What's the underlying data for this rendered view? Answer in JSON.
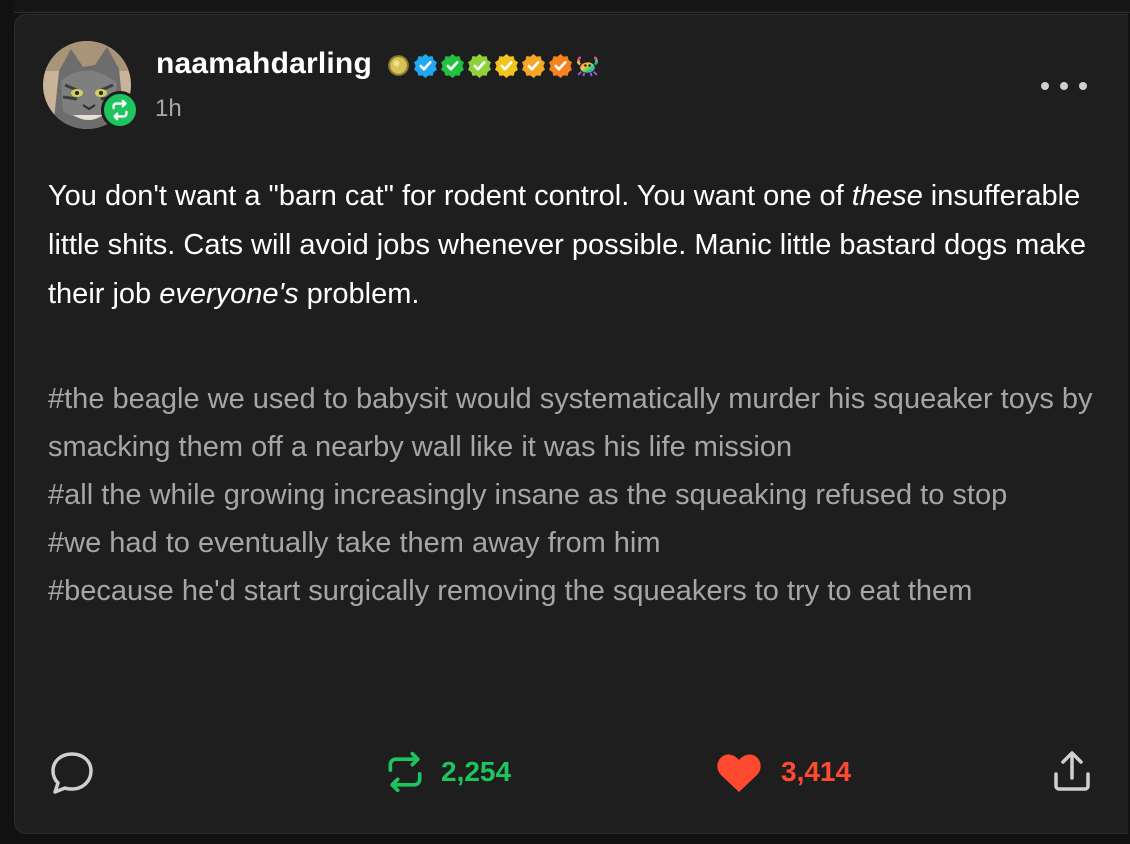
{
  "post": {
    "username": "naamahdarling",
    "timestamp": "1h",
    "body": {
      "p1_a": "You don't want a \"barn cat\" for rodent control. You want one of ",
      "p1_em": "these",
      "p1_b": " insufferable little shits. Cats will avoid jobs whenever possible. Manic little bastard dogs make their job ",
      "p1_em2": "everyone's",
      "p1_c": " problem."
    },
    "tags": [
      "#the beagle we used to babysit would systematically murder his squeaker toys by smacking them off a nearby wall like it was his life mission",
      "#all the while growing increasingly insane as the squeaking refused to stop",
      "#we had to eventually take them away from him",
      "#because he'd start surgically removing the squeakers to try to eat them"
    ],
    "reblogs": "2,254",
    "likes": "3,414"
  },
  "icons": {
    "avatar": "gray-cat-avatar",
    "reblog_badge": "reblog-icon",
    "badges": [
      "coin-badge",
      "blue-check-badge",
      "green-check-badge",
      "lime-check-badge",
      "yellow-check-badge",
      "orange-check-badge",
      "rainbow-crab-badge"
    ],
    "reply": "speech-bubble-icon",
    "reblog": "reblog-arrows-icon",
    "like": "heart-icon",
    "share": "share-upload-icon",
    "more": "ellipsis-icon"
  },
  "colors": {
    "background": "#1e1e1e",
    "text": "#ffffff",
    "muted": "#a6a6a6",
    "reblog_green": "#1ec45e",
    "like_red": "#ff4930"
  }
}
